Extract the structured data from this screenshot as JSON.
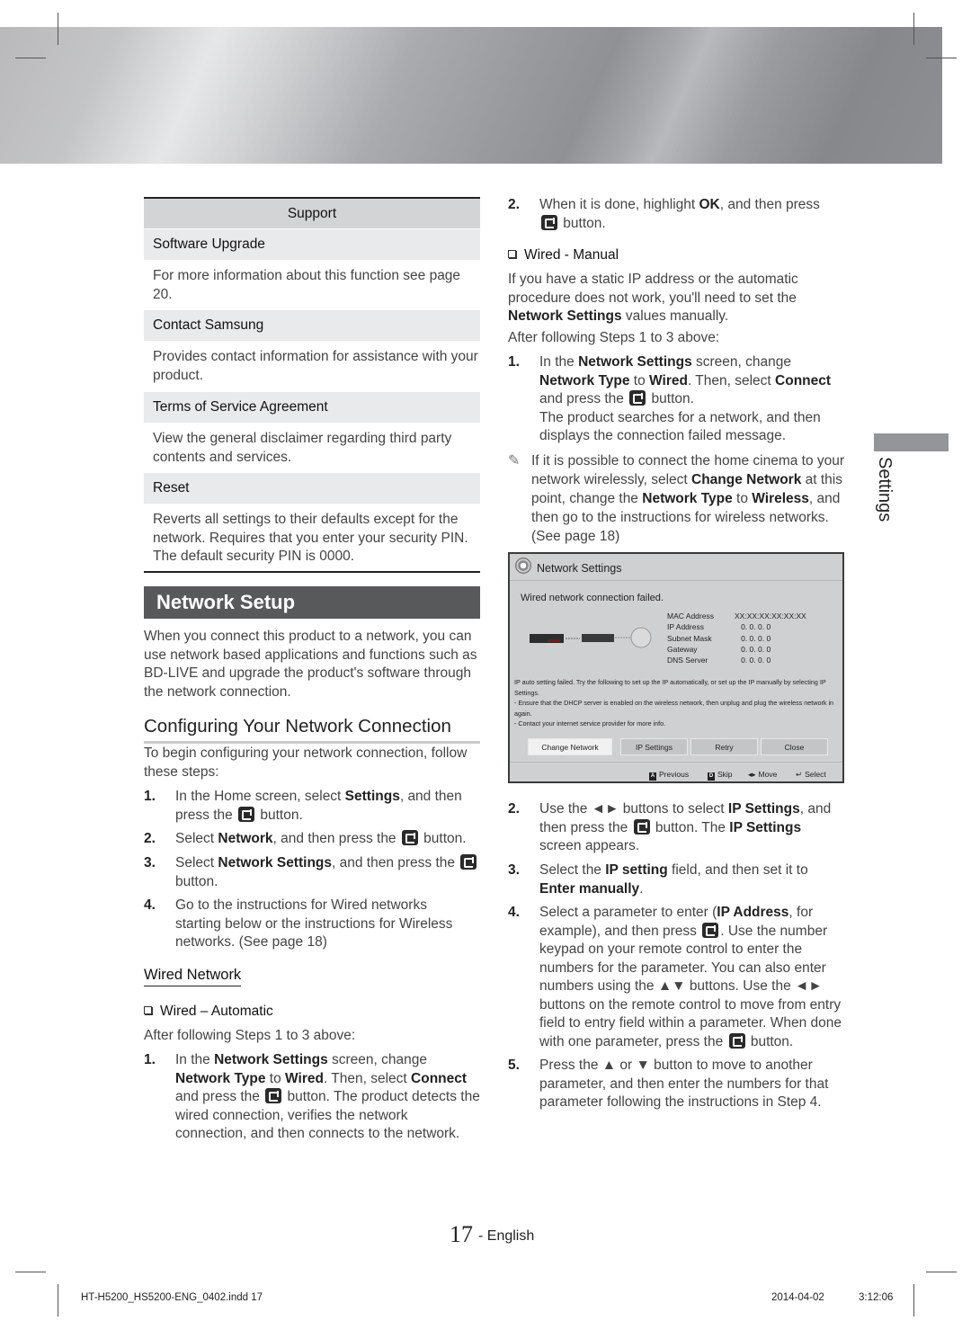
{
  "support_table": {
    "header": "Support",
    "rows": [
      {
        "title": "Software Upgrade",
        "desc": "For more information about this function see page 20."
      },
      {
        "title": "Contact Samsung",
        "desc": "Provides contact information for assistance with your product."
      },
      {
        "title": "Terms of Service Agreement",
        "desc": "View the general disclaimer regarding third party contents and services."
      },
      {
        "title": "Reset",
        "desc": "Reverts all settings to their defaults except for the network. Requires that you enter your security PIN. The default security PIN is 0000."
      }
    ]
  },
  "network_setup": {
    "title": "Network Setup",
    "intro": "When you connect this product to a network, you can use network based applications and functions such as BD-LIVE and upgrade the product's software through the network connection."
  },
  "configuring": {
    "title": "Configuring Your Network Connection",
    "intro": "To begin configuring your network connection, follow these steps:",
    "steps": [
      {
        "num": "1.",
        "pre": "In the Home screen, select ",
        "b1": "Settings",
        "mid": ", and then press the ",
        "post": " button."
      },
      {
        "num": "2.",
        "pre": "Select ",
        "b1": "Network",
        "mid": ", and then press the ",
        "post": " button."
      },
      {
        "num": "3.",
        "pre": "Select ",
        "b1": "Network Settings",
        "mid": ", and then press the ",
        "post": " button."
      },
      {
        "num": "4.",
        "text": "Go to the instructions for Wired networks starting below or the instructions for Wireless networks. (See page 18)"
      }
    ]
  },
  "wired_network": {
    "title": "Wired Network",
    "automatic": {
      "heading": "Wired – Automatic",
      "after": "After following Steps 1 to 3 above:",
      "step1": {
        "num": "1.",
        "a": "In the ",
        "b1": "Network Settings",
        "c": " screen, change ",
        "b2": "Network Type",
        "d": " to ",
        "b3": "Wired",
        "e": ". Then, select ",
        "b4": "Connect",
        "f": " and press the ",
        "g": " button. The product detects the wired connection, verifies the network connection, and then connects to the network."
      },
      "step2": {
        "num": "2.",
        "a": "When it is done, highlight ",
        "b1": "OK",
        "c": ", and then press",
        "d": " button."
      }
    },
    "manual": {
      "heading": "Wired - Manual",
      "intro_a": "If you have a static IP address or the automatic procedure does not work, you'll need to set the ",
      "intro_b": "Network Settings",
      "intro_c": " values manually.",
      "after": "After following Steps 1 to 3 above:",
      "step1": {
        "num": "1.",
        "a": "In the ",
        "b1": "Network Settings",
        "c": " screen, change ",
        "b2": "Network Type",
        "d": " to ",
        "b3": "Wired",
        "e": ". Then, select ",
        "b4": "Connect",
        "f": " and press the ",
        "g": " button.",
        "h": "The product searches for a network, and then displays the connection failed message."
      },
      "note": {
        "a": "If it is possible to connect the home cinema to your network wirelessly, select ",
        "b1": "Change Network",
        "c": " at this point, change the ",
        "b2": "Network Type",
        "d": " to ",
        "b3": "Wireless",
        "e": ", and then go to the instructions for wireless networks. (See page 18)"
      },
      "step2": {
        "num": "2.",
        "a": "Use the ◄► buttons to select ",
        "b1": "IP Settings",
        "c": ", and then press the ",
        "d": " button. The ",
        "b2": "IP Settings",
        "e": " screen appears."
      },
      "step3": {
        "num": "3.",
        "a": "Select the ",
        "b1": "IP setting",
        "c": " field, and then set it to ",
        "b2": "Enter manually",
        "d": "."
      },
      "step4": {
        "num": "4.",
        "a": "Select a parameter to enter (",
        "b1": "IP Address",
        "c": ", for example), and then press ",
        "d": ". Use the number keypad on your remote control to enter the numbers for the parameter. You can also enter numbers using the ▲▼ buttons. Use the ◄► buttons on the remote control to move from entry field to entry field within a parameter. When done with one parameter, press the ",
        "e": " button."
      },
      "step5": {
        "num": "5.",
        "text": "Press the ▲ or ▼ button to move to another parameter, and then enter the numbers for that parameter following the instructions in Step 4."
      }
    }
  },
  "screen": {
    "title": "Network Settings",
    "message": "Wired network connection failed.",
    "info": [
      {
        "label": "MAC Address",
        "value": "XX:XX:XX:XX:XX:XX"
      },
      {
        "label": "IP Address",
        "value": "0.  0.  0.  0"
      },
      {
        "label": "Subnet Mask",
        "value": "0.  0.  0.  0"
      },
      {
        "label": "Gateway",
        "value": "0.  0.  0.  0"
      },
      {
        "label": "DNS Server",
        "value": "0.  0.  0.  0"
      }
    ],
    "hint1": "IP auto setting failed. Try the following to set up the IP automatically, or set up the IP manually by selecting IP Settings.",
    "hint2": "-  Ensure that the DHCP server is enabled on the wireless network, then unplug and plug the wireless network in again.",
    "hint3": "-  Contact your internet service provider for more info.",
    "buttons": [
      "Change Network",
      "IP Settings",
      "Retry",
      "Close"
    ],
    "footer": [
      {
        "key": "A",
        "label": "Previous"
      },
      {
        "key": "D",
        "label": "Skip"
      },
      {
        "key": "◂▸",
        "label": "Move"
      },
      {
        "key": "↵",
        "label": "Select"
      }
    ]
  },
  "side_tab": {
    "label": "Settings"
  },
  "footer": {
    "page_number": "17",
    "language": "- English",
    "file": "HT-H5200_HS5200-ENG_0402.indd   17",
    "date": "2014-04-02",
    "time": "3:12:06"
  }
}
